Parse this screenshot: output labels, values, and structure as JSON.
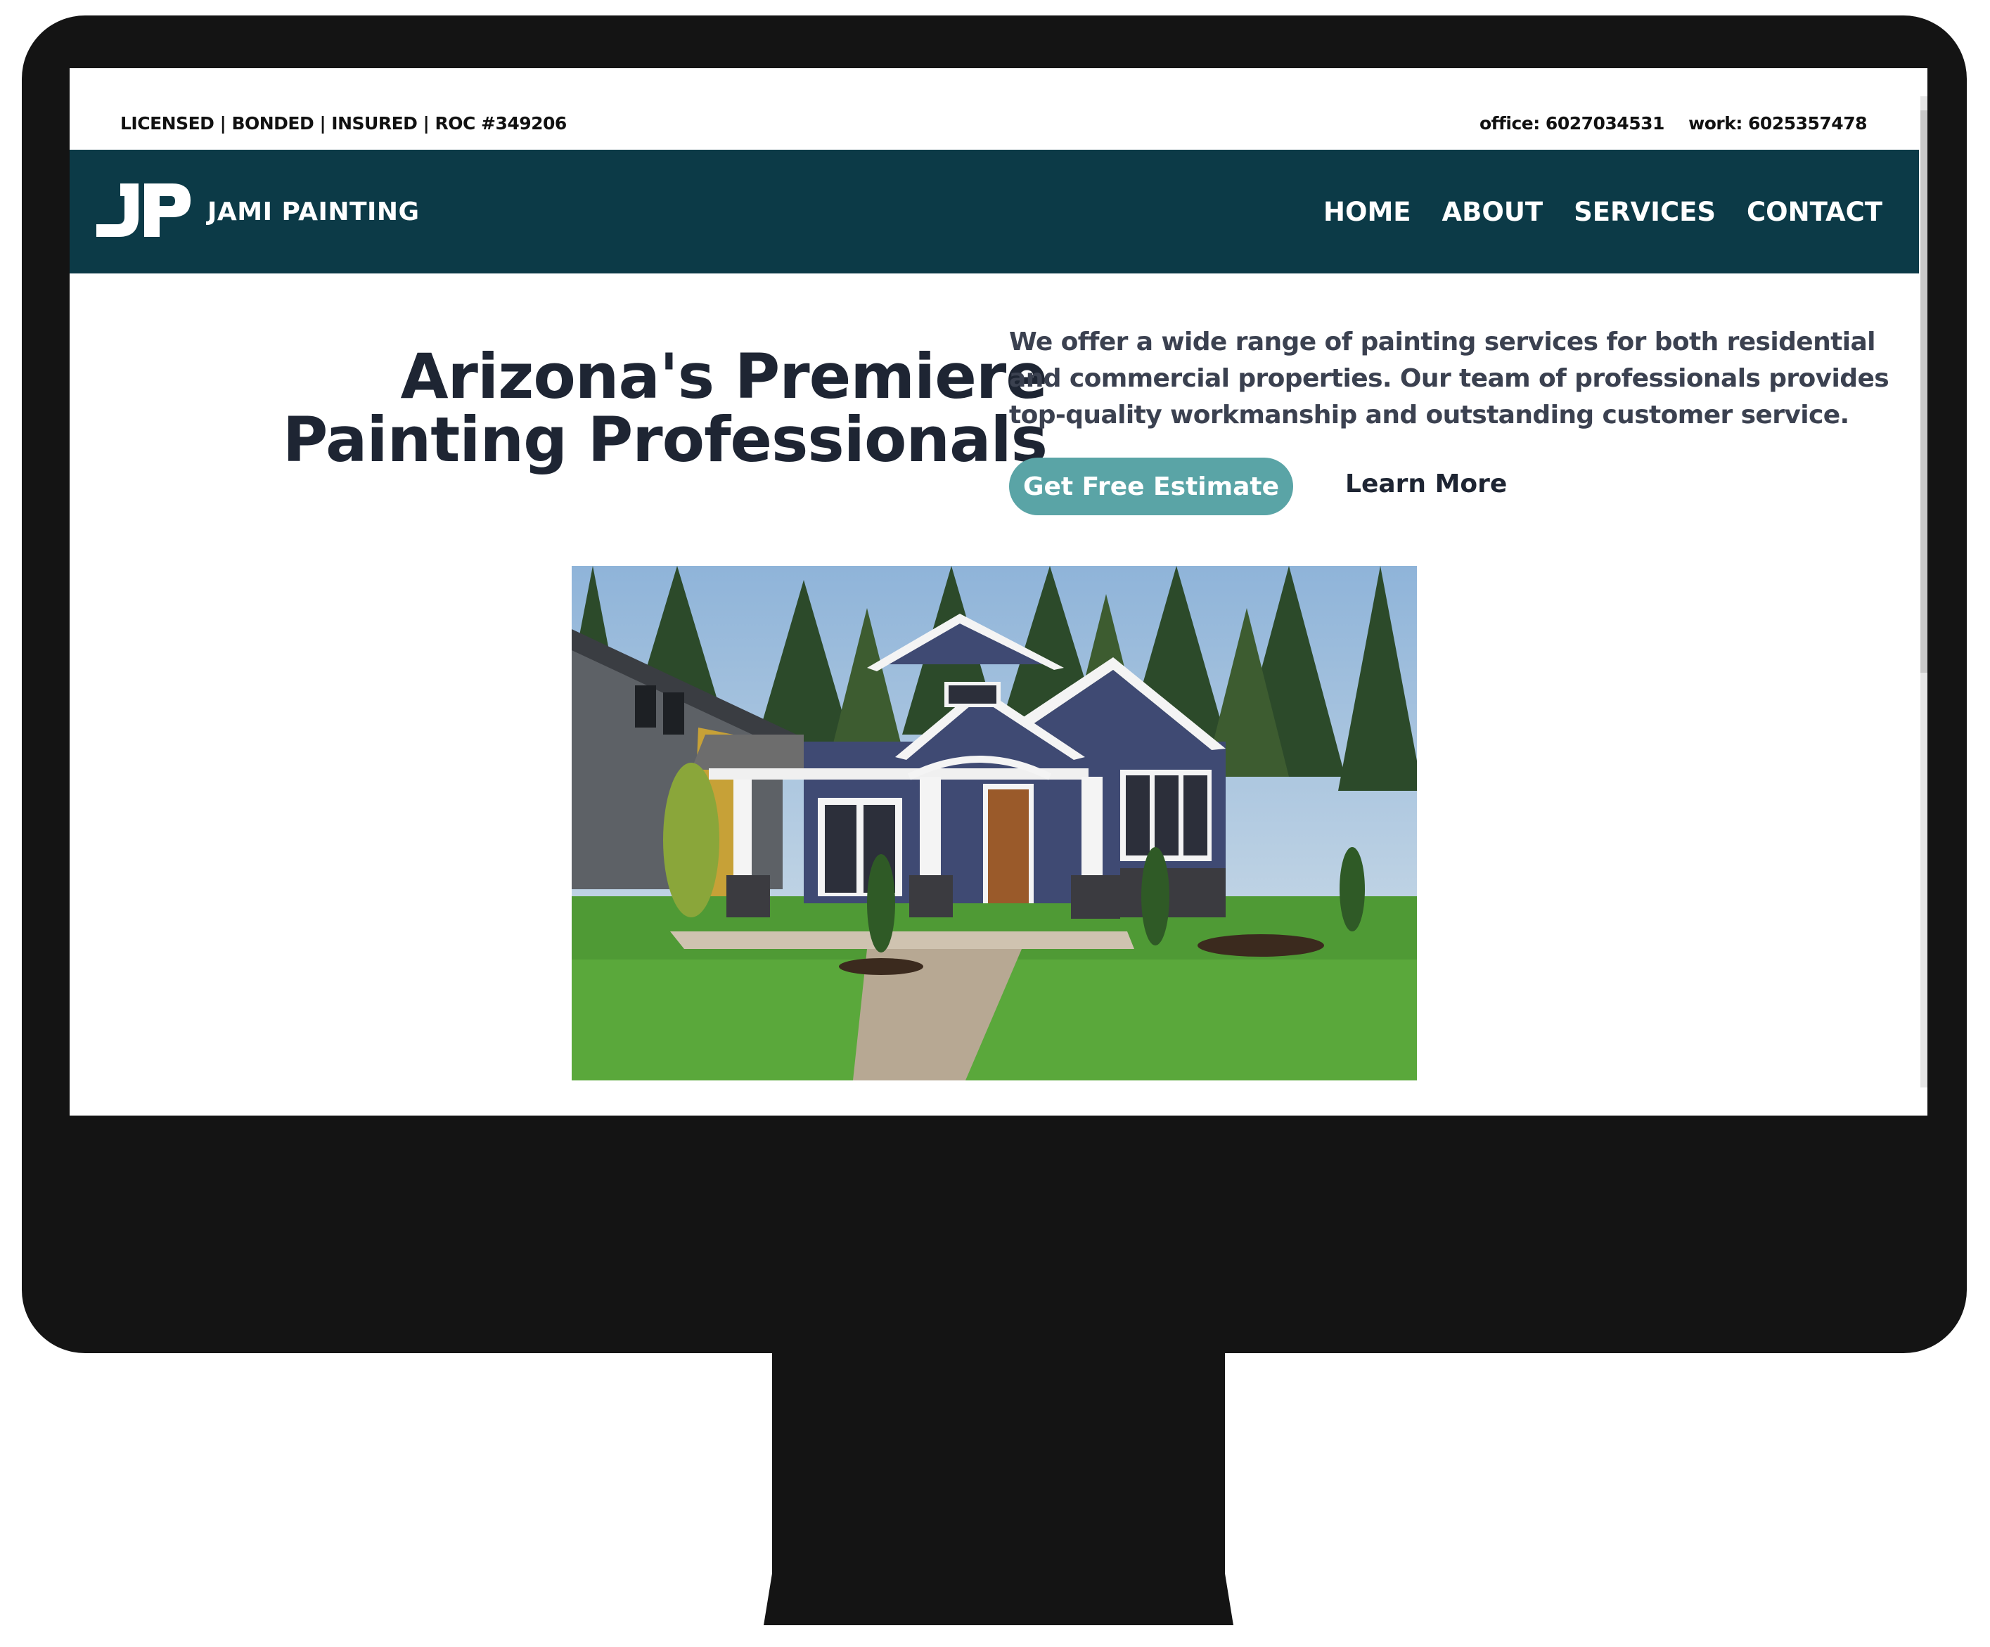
{
  "topbar": {
    "credentials": "LICENSED | BONDED | INSURED | ROC #349206",
    "office_phone": "office: 6027034531",
    "work_phone": "work: 6025357478"
  },
  "navbar": {
    "logo_icon": "jp-monogram-logo",
    "brand": "JAMI PAINTING",
    "links": [
      "HOME",
      "ABOUT",
      "SERVICES",
      "CONTACT"
    ]
  },
  "hero": {
    "title_line1": "Arizona's Premiere",
    "title_line2": "Painting Professionals",
    "description": "We offer a wide range of painting services for both residential and commercial properties. Our team of professionals provides top-quality workmanship and outstanding customer service.",
    "primary_button": "Get Free Estimate",
    "secondary_button": "Learn More",
    "image_icon": "house-photo"
  },
  "colors": {
    "nav_bg": "#0c3a47",
    "button_bg": "#5aa4a6",
    "heading": "#1e2533",
    "monitor": "#141414"
  }
}
